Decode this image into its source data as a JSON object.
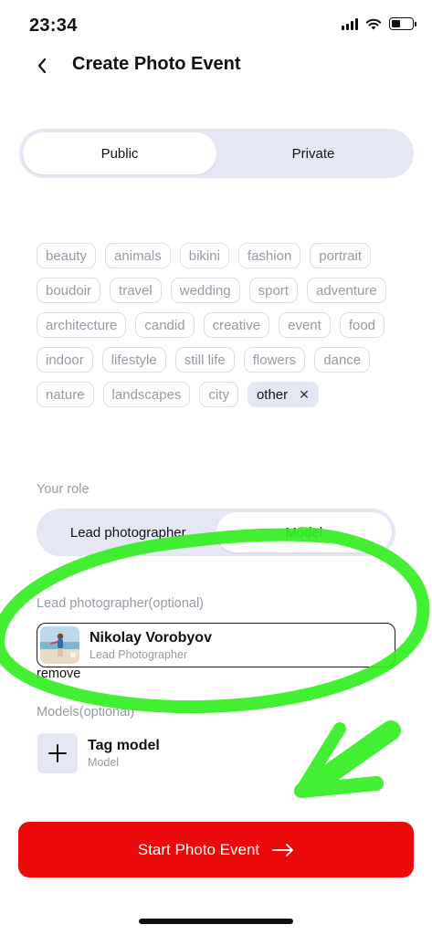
{
  "status": {
    "time": "23:34"
  },
  "nav": {
    "title": "Create Photo Event"
  },
  "visibility": {
    "options": [
      "Public",
      "Private"
    ],
    "selected": "Public"
  },
  "tags": [
    {
      "label": "beauty",
      "selected": false
    },
    {
      "label": "animals",
      "selected": false
    },
    {
      "label": "bikini",
      "selected": false
    },
    {
      "label": "fashion",
      "selected": false
    },
    {
      "label": "portrait",
      "selected": false
    },
    {
      "label": "boudoir",
      "selected": false
    },
    {
      "label": "travel",
      "selected": false
    },
    {
      "label": "wedding",
      "selected": false
    },
    {
      "label": "sport",
      "selected": false
    },
    {
      "label": "adventure",
      "selected": false
    },
    {
      "label": "architecture",
      "selected": false
    },
    {
      "label": "candid",
      "selected": false
    },
    {
      "label": "creative",
      "selected": false
    },
    {
      "label": "event",
      "selected": false
    },
    {
      "label": "food",
      "selected": false
    },
    {
      "label": "indoor",
      "selected": false
    },
    {
      "label": "lifestyle",
      "selected": false
    },
    {
      "label": "still life",
      "selected": false
    },
    {
      "label": "flowers",
      "selected": false
    },
    {
      "label": "dance",
      "selected": false
    },
    {
      "label": "nature",
      "selected": false
    },
    {
      "label": "landscapes",
      "selected": false
    },
    {
      "label": "city",
      "selected": false
    },
    {
      "label": "other",
      "selected": true
    }
  ],
  "role": {
    "label": "Your role",
    "options": [
      "Lead photographer",
      "Model"
    ],
    "selected": "Model"
  },
  "lead_photographer": {
    "label": "Lead photographer(optional)",
    "name": "Nikolay Vorobyov",
    "role": "Lead Photographer",
    "remove_label": "remove"
  },
  "models": {
    "label": "Models(optional)",
    "tag_title": "Tag model",
    "tag_sub": "Model"
  },
  "cta": {
    "label": "Start Photo Event"
  },
  "colors": {
    "accent": "#ea0a0a",
    "segment_bg": "#e6e7f4",
    "annotation": "#33ee22"
  }
}
